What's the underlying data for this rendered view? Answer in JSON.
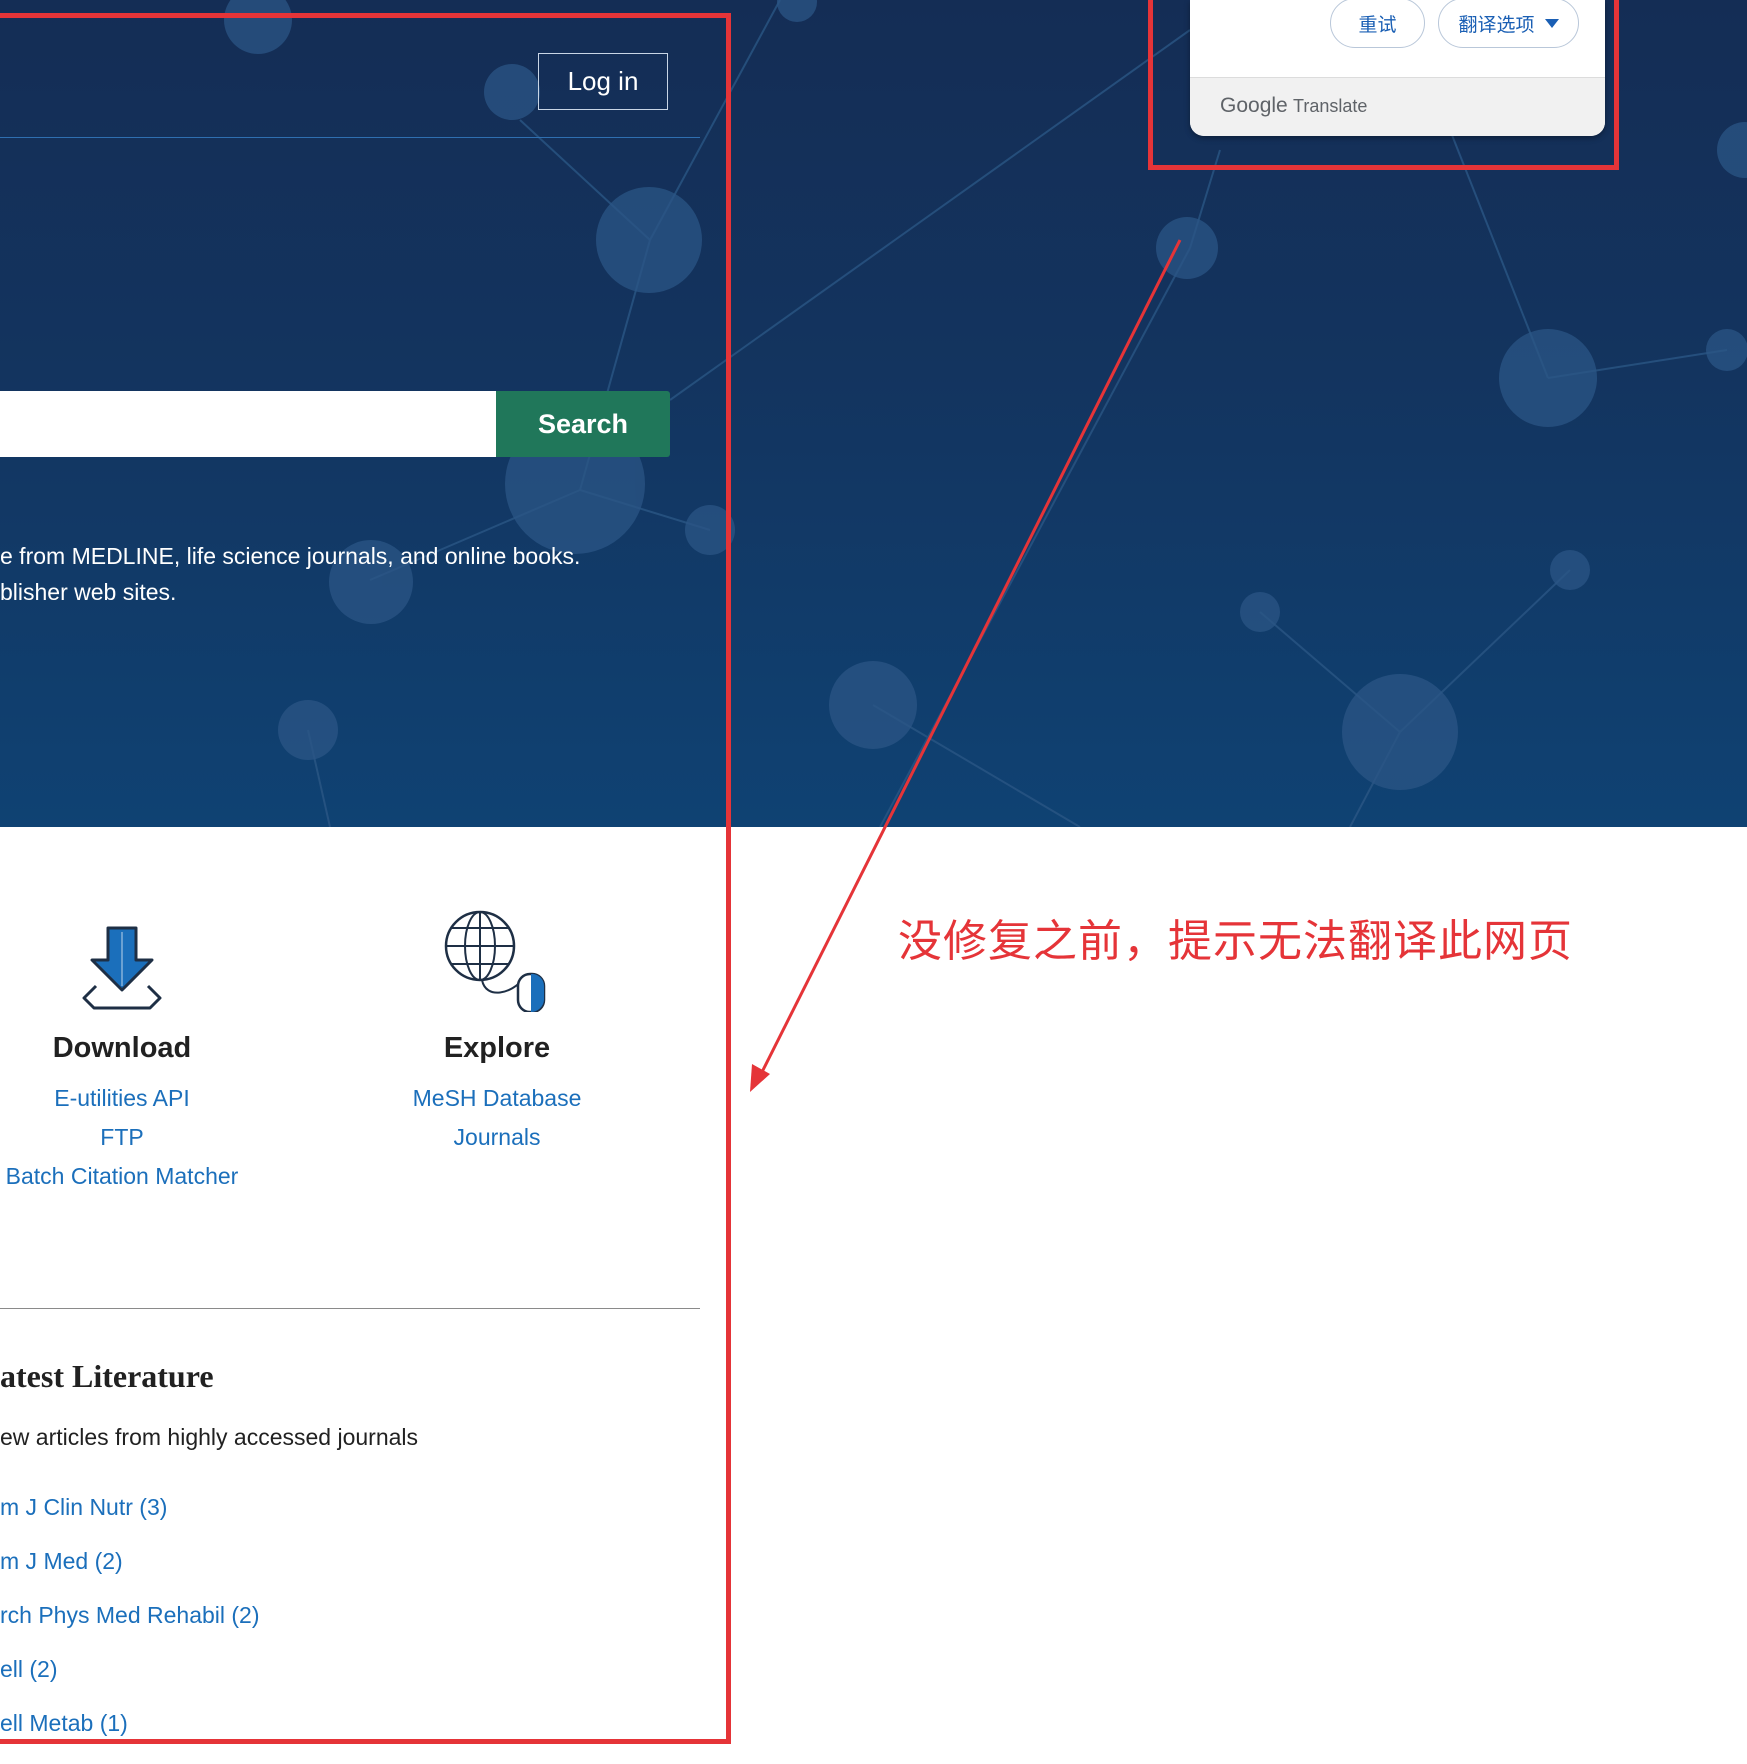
{
  "header": {
    "login_label": "Log in"
  },
  "search": {
    "button_label": "Search",
    "placeholder": ""
  },
  "description": {
    "line1": "e from MEDLINE, life science journals, and online books.",
    "line2": "blisher web sites."
  },
  "translate_popup": {
    "retry_label": "重试",
    "options_label": "翻译选项",
    "brand_google": "Google",
    "brand_translate": "Translate"
  },
  "annotation": {
    "text": "没修复之前，提示无法翻译此网页",
    "color": "#e53438"
  },
  "features": {
    "download": {
      "title": "Download",
      "icon": "download-icon",
      "links": [
        "E-utilities API",
        "FTP",
        "Batch Citation Matcher"
      ]
    },
    "explore": {
      "title": "Explore",
      "icon": "globe-mouse-icon",
      "links": [
        "MeSH Database",
        "Journals"
      ]
    }
  },
  "latest": {
    "title": "atest Literature",
    "subtitle": "ew articles from highly accessed journals",
    "journals": [
      "m J Clin Nutr (3)",
      "m J Med (2)",
      "rch Phys Med Rehabil (2)",
      "ell (2)",
      "ell Metab (1)"
    ]
  },
  "colors": {
    "hero_top": "#142d55",
    "hero_bottom": "#0f4273",
    "search_button": "#20775a",
    "link": "#1b6fbb",
    "annotation_red": "#e53438"
  }
}
